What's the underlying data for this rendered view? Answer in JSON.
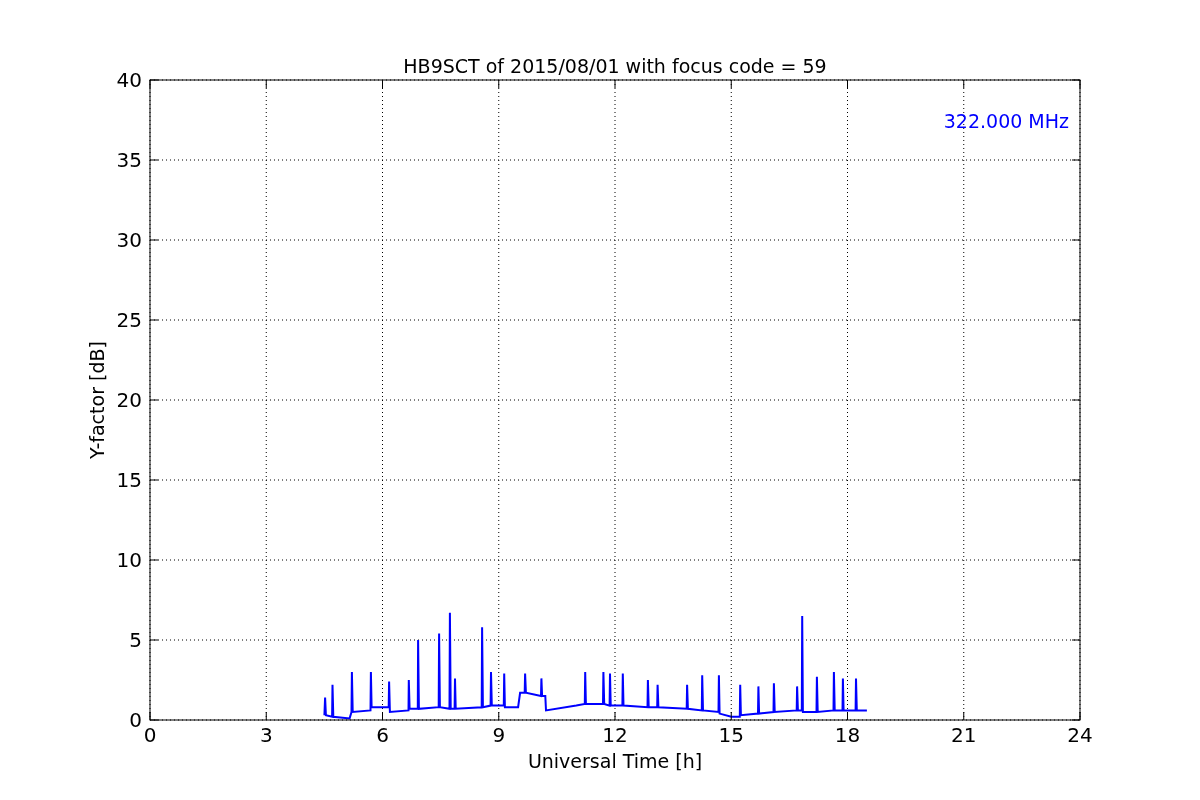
{
  "chart_data": {
    "type": "line",
    "title": "HB9SCT of 2015/08/01 with focus code = 59",
    "xlabel": "Universal Time [h]",
    "ylabel": "Y-factor [dB]",
    "xlim": [
      0,
      24
    ],
    "ylim": [
      0,
      40
    ],
    "xticks": [
      0,
      3,
      6,
      9,
      12,
      15,
      18,
      21,
      24
    ],
    "yticks": [
      0,
      5,
      10,
      15,
      20,
      25,
      30,
      35,
      40
    ],
    "x": [
      4.5,
      4.52,
      4.54,
      4.7,
      4.71,
      4.73,
      5.15,
      5.2,
      5.21,
      5.23,
      5.69,
      5.7,
      5.72,
      6.16,
      6.17,
      6.19,
      6.67,
      6.68,
      6.7,
      6.91,
      6.92,
      6.94,
      7.45,
      7.46,
      7.48,
      7.73,
      7.74,
      7.76,
      7.86,
      7.87,
      7.89,
      8.56,
      8.57,
      8.59,
      8.79,
      8.8,
      8.82,
      9.13,
      9.14,
      9.16,
      9.5,
      9.55,
      9.67,
      9.68,
      9.7,
      10.09,
      10.1,
      10.12,
      10.2,
      10.22,
      11.0,
      11.22,
      11.23,
      11.25,
      11.69,
      11.7,
      11.72,
      11.86,
      11.87,
      11.89,
      12.19,
      12.2,
      12.22,
      12.84,
      12.85,
      12.87,
      13.09,
      13.1,
      13.12,
      13.85,
      13.86,
      13.88,
      14.24,
      14.25,
      14.27,
      14.67,
      14.68,
      14.7,
      15.0,
      15.22,
      15.23,
      15.25,
      15.69,
      15.7,
      15.72,
      16.09,
      16.1,
      16.12,
      16.69,
      16.7,
      16.72,
      16.82,
      16.83,
      16.85,
      17.2,
      17.21,
      17.23,
      17.64,
      17.65,
      17.67,
      17.87,
      17.88,
      17.9,
      18.21,
      18.22,
      18.24,
      18.5
    ],
    "series": [
      {
        "name": "322.000 MHz",
        "color": "#0000ff",
        "values": [
          0.3,
          1.4,
          0.3,
          0.2,
          2.2,
          0.2,
          0.1,
          0.5,
          3.0,
          0.5,
          0.6,
          3.0,
          0.8,
          0.8,
          2.4,
          0.5,
          0.6,
          2.5,
          0.7,
          0.7,
          5.0,
          0.7,
          0.8,
          5.4,
          0.8,
          0.7,
          6.7,
          0.7,
          0.7,
          2.6,
          0.7,
          0.8,
          5.8,
          0.8,
          0.9,
          3.0,
          0.9,
          0.9,
          2.9,
          0.8,
          0.8,
          1.7,
          1.7,
          2.9,
          1.7,
          1.5,
          2.6,
          1.5,
          1.5,
          0.6,
          0.9,
          1.0,
          3.0,
          1.0,
          1.0,
          3.0,
          1.0,
          0.9,
          2.9,
          0.9,
          0.9,
          2.9,
          0.9,
          0.8,
          2.5,
          0.8,
          0.8,
          2.2,
          0.8,
          0.7,
          2.2,
          0.7,
          0.6,
          2.8,
          0.6,
          0.5,
          2.8,
          0.4,
          0.2,
          0.2,
          2.2,
          0.3,
          0.4,
          2.1,
          0.4,
          0.5,
          2.3,
          0.5,
          0.6,
          2.1,
          0.6,
          0.6,
          6.5,
          0.5,
          0.5,
          2.7,
          0.5,
          0.6,
          3.0,
          0.6,
          0.6,
          2.6,
          0.6,
          0.6,
          2.6,
          0.6,
          0.6
        ]
      }
    ],
    "grid": true
  }
}
